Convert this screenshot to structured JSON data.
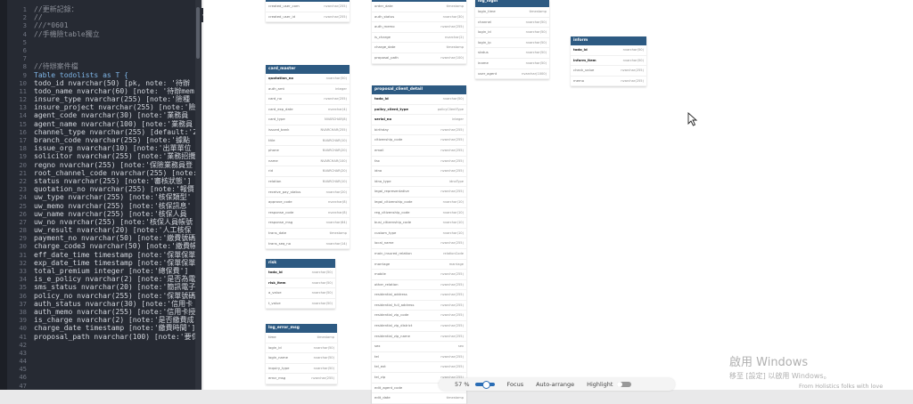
{
  "editor": {
    "line_numbers": [
      "1",
      "2",
      "3",
      "4",
      "5",
      "6",
      "7",
      "8",
      "9",
      "10",
      "11",
      "12",
      "13",
      "14",
      "15",
      "16",
      "17",
      "18",
      "19",
      "20",
      "21",
      "22",
      "23",
      "24",
      "25",
      "26",
      "27",
      "28",
      "29",
      "30",
      "31",
      "32",
      "33",
      "34",
      "35",
      "36",
      "37",
      "38",
      "39",
      "40",
      "41",
      "42",
      "43",
      "44",
      "45",
      "46",
      "47"
    ],
    "lines": [
      "//更新記錄：",
      "//",
      "///*0601",
      "//手機險table獨立",
      "",
      "",
      "",
      "//待辦案件檔",
      "Table todolists as T {",
      "  todo_id nvarchar(50) [pk, note: '待辦",
      "  todo_name nvarchar(60) [note: '待辦mem",
      "  insure_type nvarchar(255) [note:'險種",
      "  insure_project nvarchar(255) [note:'險",
      "  agent_code nvarchar(30) [note:'業務員",
      "  agent_name nvarchar(100) [note:'業務員",
      "  channel_type nvarchar(255) [default:'2",
      "  branch_code nvarchar(255) [note:'據點",
      "  issue_org  nvarchar(10) [note:'出單單位",
      "  solicitor nvarchar(255) [note:'業務招攬",
      "  regno nvarchar(255) [note:'保險業務員登",
      "  root_channel_code nvarchar(255) [note:",
      "  status nvarchar(255) [note:'審核狀態']",
      "  quotation_no nvarchar(255) [note:'報價",
      "  uw_type nvarchar(255) [note:'核保類型'",
      "  uw_memo nvarchar(255) [note:'核保訊息'",
      "  uw_name nvarchar(255) [note:'核保人員",
      "  uw_no nvarchar(255) [note:'核保人員帳號",
      "  uw_result nvarchar(20) [note:'人工核保",
      "  payment_no nvarchar(50) [note:'繳費號碼",
      "  charge_code3 nvarchar(50) [note:'繳費帳",
      "  eff_date_time timestamp [note:'保單保單",
      "  exp_date_time timestamp [note:'保單保單",
      "  total_premium integer [note:'總保費']",
      "  is_e_policy nvarchar(2) [note:'是否為電",
      "  sms_status nvarchar(20) [note:'簡訊電子",
      "  policy_no nvarchar(255) [note:'保單號碼",
      "  auth_status nvarchar(30) [note:'信用卡",
      "  auth_memo nvarchar(255) [note:'信用卡授",
      "  is_charge nvarchar(2) [note:'是否繳費成",
      "  charge_date timestamp [note:'繳費時間']",
      "  proposal_path nvarchar(100) [note:'要保",
      "",
      "",
      "",
      "",
      "",
      ""
    ]
  },
  "tables": [
    {
      "id": "t-top1",
      "title": "",
      "rows": [
        {
          "n": "created_user_com",
          "t": "nvarchar(255)",
          "pk": false
        },
        {
          "n": "created_user_id",
          "t": "nvarchar(255)",
          "pk": false
        }
      ]
    },
    {
      "id": "t-top2",
      "title": "",
      "rows": [
        {
          "n": "order_date",
          "t": "timestamp",
          "pk": false
        },
        {
          "n": "auth_status",
          "t": "nvarchar(30)",
          "pk": false
        },
        {
          "n": "auth_memo",
          "t": "nvarchar(255)",
          "pk": false
        },
        {
          "n": "is_charge",
          "t": "nvarchar(2)",
          "pk": false
        },
        {
          "n": "charge_date",
          "t": "timestamp",
          "pk": false
        },
        {
          "n": "proposal_path",
          "t": "nvarchar(100)",
          "pk": false
        }
      ]
    },
    {
      "id": "t-log-login",
      "title": "log_login",
      "rows": [
        {
          "n": "login_time",
          "t": "timestamp",
          "pk": false
        },
        {
          "n": "channel",
          "t": "nvarchar(50)",
          "pk": false
        },
        {
          "n": "login_id",
          "t": "nvarchar(50)",
          "pk": false
        },
        {
          "n": "login_ip",
          "t": "nvarchar(50)",
          "pk": false
        },
        {
          "n": "status",
          "t": "nvarchar(50)",
          "pk": false
        },
        {
          "n": "iname",
          "t": "nvarchar(50)",
          "pk": false
        },
        {
          "n": "user_agent",
          "t": "nvarchar(1000)",
          "pk": false
        }
      ]
    },
    {
      "id": "t-inform",
      "title": "inform",
      "rows": [
        {
          "n": "todo_id",
          "t": "nvarchar(50)",
          "pk": true
        },
        {
          "n": "inform_item",
          "t": "nvarchar(50)",
          "pk": true
        },
        {
          "n": "check_value",
          "t": "nvarchar(255)",
          "pk": false
        },
        {
          "n": "memo",
          "t": "nvarchar(255)",
          "pk": false
        }
      ]
    },
    {
      "id": "t-card-master",
      "title": "card_master",
      "rows": [
        {
          "n": "quotation_no",
          "t": "nvarchar(50)",
          "pk": true
        },
        {
          "n": "auth_amt",
          "t": "integer",
          "pk": false
        },
        {
          "n": "card_no",
          "t": "nvarchar(255)",
          "pk": false
        },
        {
          "n": "card_exp_date",
          "t": "nvarchar(4)",
          "pk": false
        },
        {
          "n": "card_type",
          "t": "NVARCHAR(8)",
          "pk": false
        },
        {
          "n": "issued_bank",
          "t": "NVARCHAR(255)",
          "pk": false
        },
        {
          "n": "title",
          "t": "NVARCHAR(10)",
          "pk": false
        },
        {
          "n": "phone",
          "t": "NVARCHAR(20)",
          "pk": false
        },
        {
          "n": "name",
          "t": "NVARCHAR(100)",
          "pk": false
        },
        {
          "n": "rid",
          "t": "NVARCHAR(20)",
          "pk": false
        },
        {
          "n": "relation",
          "t": "NVARCHAR(10)",
          "pk": false
        },
        {
          "n": "receive_pay_status",
          "t": "nvarchar(20)",
          "pk": false
        },
        {
          "n": "approve_code",
          "t": "nvarchar(8)",
          "pk": false
        },
        {
          "n": "response_code",
          "t": "nvarchar(8)",
          "pk": false
        },
        {
          "n": "response_msg",
          "t": "nvarchar(64)",
          "pk": false
        },
        {
          "n": "trans_date",
          "t": "timestamp",
          "pk": false
        },
        {
          "n": "trans_seq_no",
          "t": "nvarchar(14)",
          "pk": false
        }
      ]
    },
    {
      "id": "t-proposal",
      "title": "proposal_client_detail",
      "rows": [
        {
          "n": "todo_id",
          "t": "nvarchar(50)",
          "pk": true
        },
        {
          "n": "policy_client_type",
          "t": "policyClientType",
          "pk": true
        },
        {
          "n": "serial_no",
          "t": "integer",
          "pk": true
        },
        {
          "n": "birthday",
          "t": "nvarchar(255)",
          "pk": false
        },
        {
          "n": "citizenship_code",
          "t": "nvarchar(255)",
          "pk": false
        },
        {
          "n": "email",
          "t": "nvarchar(255)",
          "pk": false
        },
        {
          "n": "fax",
          "t": "nvarchar(255)",
          "pk": false
        },
        {
          "n": "idno",
          "t": "nvarchar(255)",
          "pk": false
        },
        {
          "n": "idno_type",
          "t": "idnoType",
          "pk": false
        },
        {
          "n": "legal_representative",
          "t": "nvarchar(255)",
          "pk": false
        },
        {
          "n": "legal_citizenship_code",
          "t": "nvarchar(10)",
          "pk": false
        },
        {
          "n": "reg_citizenship_code",
          "t": "nvarchar(10)",
          "pk": false
        },
        {
          "n": "busi_citizenship_code",
          "t": "nvarchar(10)",
          "pk": false
        },
        {
          "n": "custom_type",
          "t": "nvarchar(10)",
          "pk": false
        },
        {
          "n": "local_name",
          "t": "nvarchar(255)",
          "pk": false
        },
        {
          "n": "main_insured_relation",
          "t": "relationCode",
          "pk": false
        },
        {
          "n": "marriage",
          "t": "marriage",
          "pk": false
        },
        {
          "n": "mobile",
          "t": "nvarchar(255)",
          "pk": false
        },
        {
          "n": "other_relation",
          "t": "nvarchar(255)",
          "pk": false
        },
        {
          "n": "residential_address",
          "t": "nvarchar(255)",
          "pk": false
        },
        {
          "n": "residential_full_address",
          "t": "nvarchar(255)",
          "pk": false
        },
        {
          "n": "residential_zip_code",
          "t": "nvarchar(255)",
          "pk": false
        },
        {
          "n": "residential_zip_district",
          "t": "nvarchar(255)",
          "pk": false
        },
        {
          "n": "residential_zip_name",
          "t": "nvarchar(255)",
          "pk": false
        },
        {
          "n": "sex",
          "t": "sex",
          "pk": false
        },
        {
          "n": "tel",
          "t": "nvarchar(255)",
          "pk": false
        },
        {
          "n": "tel_ext",
          "t": "nvarchar(255)",
          "pk": false
        },
        {
          "n": "tel_zip",
          "t": "nvarchar(255)",
          "pk": false
        },
        {
          "n": "edit_agent_code",
          "t": "nvarchar(50)",
          "pk": false
        },
        {
          "n": "edit_date",
          "t": "timestamp",
          "pk": false
        }
      ]
    },
    {
      "id": "t-risk",
      "title": "risk",
      "rows": [
        {
          "n": "todo_id",
          "t": "nvarchar(50)",
          "pk": true
        },
        {
          "n": "risk_item",
          "t": "nvarchar(50)",
          "pk": true
        },
        {
          "n": "a_value",
          "t": "nvarchar(50)",
          "pk": false
        },
        {
          "n": "t_value",
          "t": "nvarchar(50)",
          "pk": false
        }
      ]
    },
    {
      "id": "t-log-error",
      "title": "log_error_msg",
      "rows": [
        {
          "n": "time",
          "t": "timestamp",
          "pk": false
        },
        {
          "n": "login_id",
          "t": "nvarchar(50)",
          "pk": false
        },
        {
          "n": "login_name",
          "t": "nvarchar(50)",
          "pk": false
        },
        {
          "n": "inquiry_type",
          "t": "nvarchar(50)",
          "pk": false
        },
        {
          "n": "error_msg",
          "t": "nvarchar(255)",
          "pk": false
        }
      ]
    }
  ],
  "toolbar": {
    "zoom": "57 %",
    "focus": "Focus",
    "auto_arrange": "Auto-arrange",
    "highlight": "Highlight"
  },
  "watermark": {
    "line1": "啟用 Windows",
    "line2": "移至 [設定] 以啟用 Windows。",
    "footer": "From Holistics folks with love"
  },
  "colors": {
    "table_header": "#2d5a82",
    "editor_bg": "#262a33",
    "toggle_on": "#2a6db5"
  }
}
